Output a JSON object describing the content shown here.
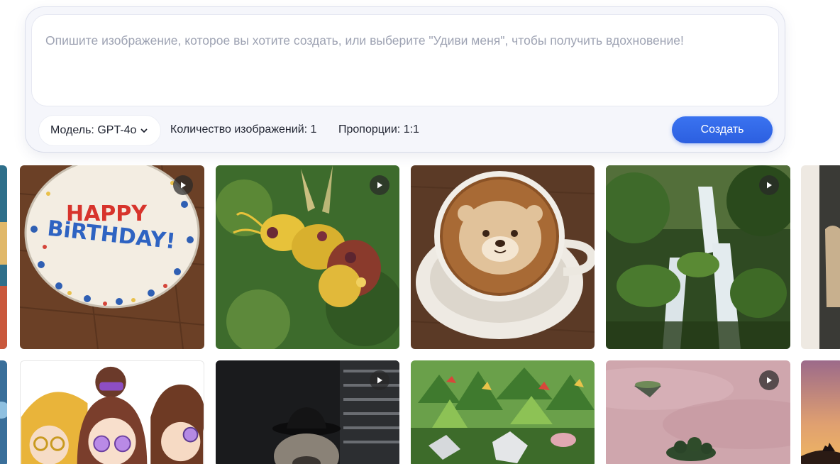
{
  "prompt": {
    "placeholder": "Опишите изображение, которое вы хотите создать, или выберите \"Удиви меня\", чтобы получить вдохновение!"
  },
  "controls": {
    "model_label": "Модель: GPT-4o",
    "count_label": "Количество изображений: 1",
    "ratio_label": "Пропорции: 1:1",
    "create_label": "Создать"
  },
  "gallery": {
    "row1": [
      "birthday-cake",
      "flower-bee",
      "otter-latte",
      "waterfall-forest",
      "coat-partial"
    ],
    "row2": [
      "anime-friends",
      "noir-bulldog",
      "origami-jungle",
      "floating-islands",
      "desert-sunset"
    ],
    "cake_text": [
      "HAPPY",
      "BiRTHDAY!"
    ]
  },
  "colors": {
    "accent": "#2f63e6",
    "panel_bg": "#f5f6fb",
    "placeholder": "#9ea3b3"
  }
}
